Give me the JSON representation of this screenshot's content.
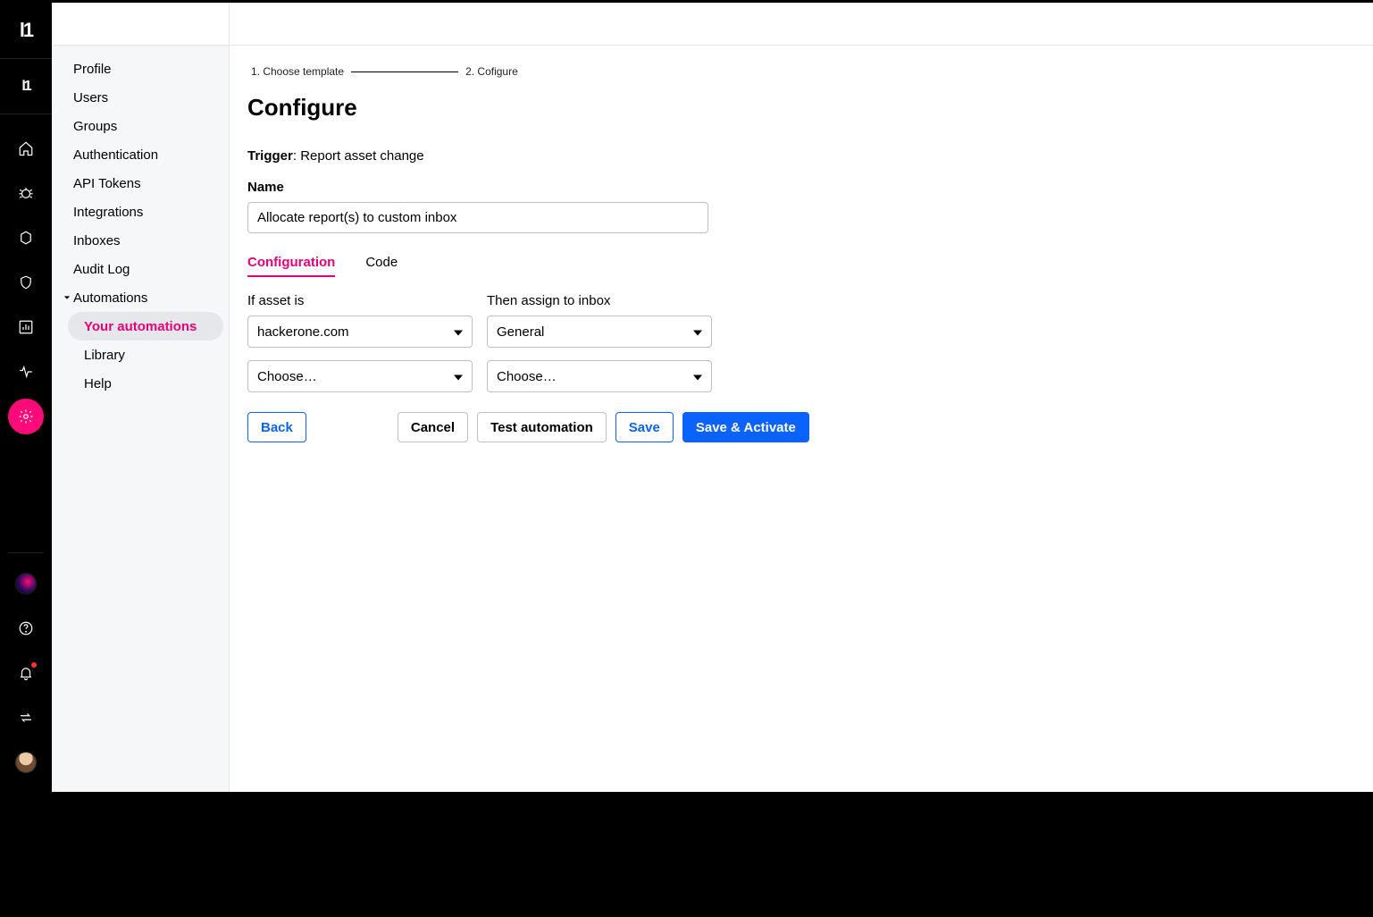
{
  "nav": {
    "profile": "Profile",
    "users": "Users",
    "groups": "Groups",
    "authentication": "Authentication",
    "apiTokens": "API Tokens",
    "integrations": "Integrations",
    "inboxes": "Inboxes",
    "auditLog": "Audit Log",
    "automations": "Automations",
    "yourAutomations": "Your automations",
    "library": "Library",
    "help": "Help"
  },
  "steps": {
    "one": "1.   Choose template",
    "two": "2.   Cofigure"
  },
  "page": {
    "title": "Configure",
    "triggerLabel": "Trigger",
    "triggerValue": ": Report asset change",
    "nameLabel": "Name",
    "nameValue": "Allocate report(s) to custom inbox"
  },
  "tabs": {
    "configuration": "Configuration",
    "code": "Code"
  },
  "cond": {
    "ifLabel": "If asset is",
    "thenLabel": "Then assign to inbox",
    "asset1": "hackerone.com",
    "inbox1": "General",
    "choose": "Choose…"
  },
  "buttons": {
    "back": "Back",
    "cancel": "Cancel",
    "test": "Test automation",
    "save": "Save",
    "saveActivate": "Save & Activate"
  }
}
